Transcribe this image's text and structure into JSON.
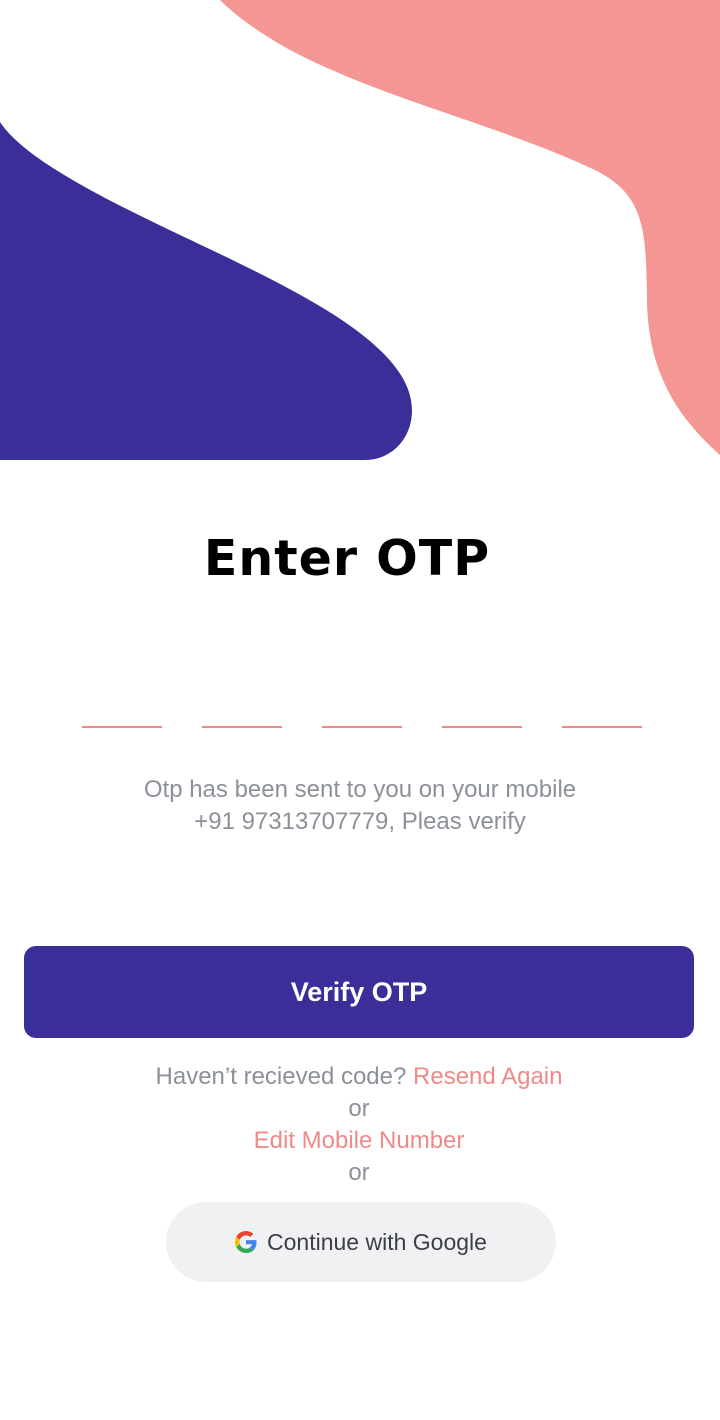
{
  "page": {
    "title": "Enter OTP"
  },
  "otp": {
    "digit_count": 5,
    "values": [
      "",
      "",
      "",
      "",
      ""
    ]
  },
  "info": {
    "line1": "Otp has been sent to you on your mobile",
    "line2": "+91 97313707779, Pleas verify"
  },
  "actions": {
    "verify_label": "Verify OTP",
    "not_received_text": "Haven’t recieved code? ",
    "resend_label": "Resend Again",
    "or_text_1": "or",
    "edit_mobile_label": "Edit Mobile Number",
    "or_text_2": "or",
    "google_label": "Continue with Google"
  },
  "icons": {
    "google": "google-g-icon"
  },
  "colors": {
    "primary": "#3a2f99",
    "accent": "#f08a88",
    "blob_pink": "#f39694",
    "muted_text": "#8c9099",
    "google_button_bg": "#f0f1f3"
  }
}
